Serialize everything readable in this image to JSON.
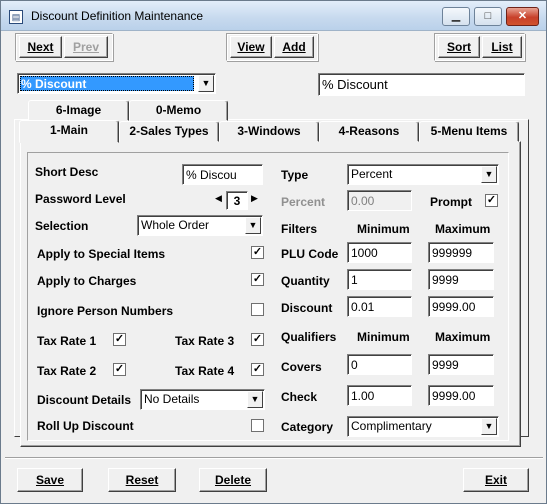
{
  "window": {
    "title": "Discount Definition Maintenance",
    "min": "▁",
    "max": "□",
    "close": "✕"
  },
  "toolbar": {
    "next": "Next",
    "prev": "Prev",
    "view": "View",
    "add": "Add",
    "sort": "Sort",
    "list": "List"
  },
  "selector": {
    "value": "% Discount",
    "name_field": "% Discount"
  },
  "tabs_back": [
    {
      "label": "6-Image"
    },
    {
      "label": "0-Memo"
    }
  ],
  "tabs_front": [
    {
      "label": "1-Main"
    },
    {
      "label": "2-Sales Types"
    },
    {
      "label": "3-Windows"
    },
    {
      "label": "4-Reasons"
    },
    {
      "label": "5-Menu Items"
    }
  ],
  "main": {
    "short_desc_label": "Short Desc",
    "short_desc_value": "% Discou",
    "password_label": "Password Level",
    "password_value": "3",
    "selection_label": "Selection",
    "selection_value": "Whole Order",
    "apply_special_label": "Apply to Special Items",
    "apply_special_checked": true,
    "apply_charges_label": "Apply to Charges",
    "apply_charges_checked": true,
    "ignore_person_label": "Ignore Person Numbers",
    "ignore_person_checked": false,
    "tax1_label": "Tax Rate 1",
    "tax1_checked": true,
    "tax2_label": "Tax Rate 2",
    "tax2_checked": true,
    "tax3_label": "Tax Rate 3",
    "tax3_checked": true,
    "tax4_label": "Tax Rate 4",
    "tax4_checked": true,
    "details_label": "Discount Details",
    "details_value": "No Details",
    "rollup_label": "Roll Up Discount",
    "rollup_checked": false,
    "type_label": "Type",
    "type_value": "Percent",
    "percent_label": "Percent",
    "percent_value": "0.00",
    "prompt_label": "Prompt",
    "prompt_checked": true,
    "filters_label": "Filters",
    "minimum_label": "Minimum",
    "maximum_label": "Maximum",
    "plu_label": "PLU Code",
    "plu_min": "1000",
    "plu_max": "999999",
    "qty_label": "Quantity",
    "qty_min": "1",
    "qty_max": "9999",
    "disc_label": "Discount",
    "disc_min": "0.01",
    "disc_max": "9999.00",
    "qualifiers_label": "Qualifiers",
    "qmin_label": "Minimum",
    "qmax_label": "Maximum",
    "covers_label": "Covers",
    "covers_min": "0",
    "covers_max": "9999",
    "check_label": "Check",
    "check_min": "1.00",
    "check_max": "9999.00",
    "category_label": "Category",
    "category_value": "Complimentary"
  },
  "footer": {
    "save": "Save",
    "reset": "Reset",
    "delete": "Delete",
    "exit": "Exit"
  }
}
